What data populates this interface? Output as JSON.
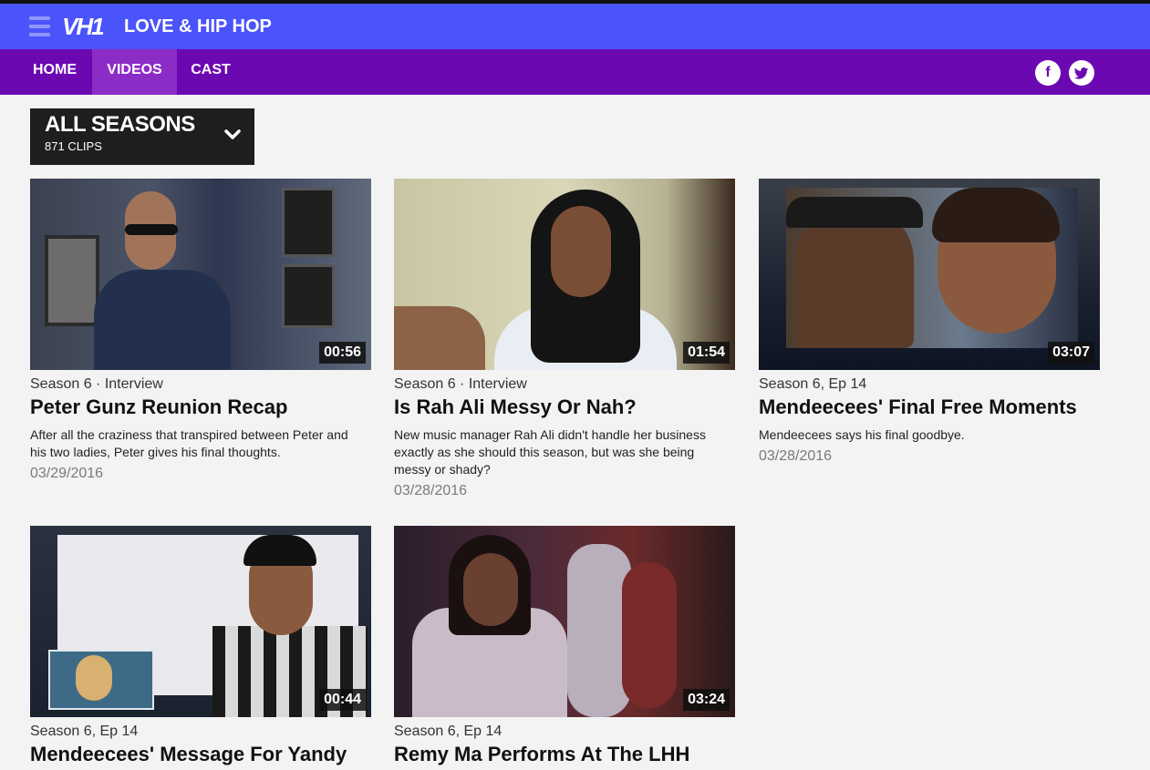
{
  "header": {
    "logo": "VH1",
    "show_title": "LOVE & HIP HOP"
  },
  "nav": {
    "items": [
      "HOME",
      "VIDEOS",
      "CAST"
    ],
    "active": "VIDEOS"
  },
  "social": {
    "facebook": "f",
    "twitter": "t"
  },
  "season_selector": {
    "label": "ALL SEASONS",
    "count": "871 CLIPS"
  },
  "videos": [
    {
      "duration": "00:56",
      "meta": "Season 6 · Interview",
      "title": "Peter Gunz Reunion Recap",
      "description": "After all the craziness that transpired between Peter and his two ladies, Peter gives his final thoughts.",
      "date": "03/29/2016"
    },
    {
      "duration": "01:54",
      "meta": "Season 6 · Interview",
      "title": "Is Rah Ali Messy Or Nah?",
      "description": "New music manager Rah Ali didn't handle her business exactly as she should this season, but was she being messy or shady?",
      "date": "03/28/2016"
    },
    {
      "duration": "03:07",
      "meta": "Season 6, Ep 14",
      "title": "Mendeecees' Final Free Moments",
      "description": "Mendeecees says his final goodbye.",
      "date": "03/28/2016"
    },
    {
      "duration": "00:44",
      "meta": "Season 6, Ep 14",
      "title": "Mendeecees' Message For Yandy"
    },
    {
      "duration": "03:24",
      "meta": "Season 6, Ep 14",
      "title": "Remy Ma Performs At The LHH"
    }
  ],
  "colors": {
    "top_bar": "#4b53fa",
    "nav_bar": "#6c08b1",
    "nav_active": "#8c2cc6"
  }
}
